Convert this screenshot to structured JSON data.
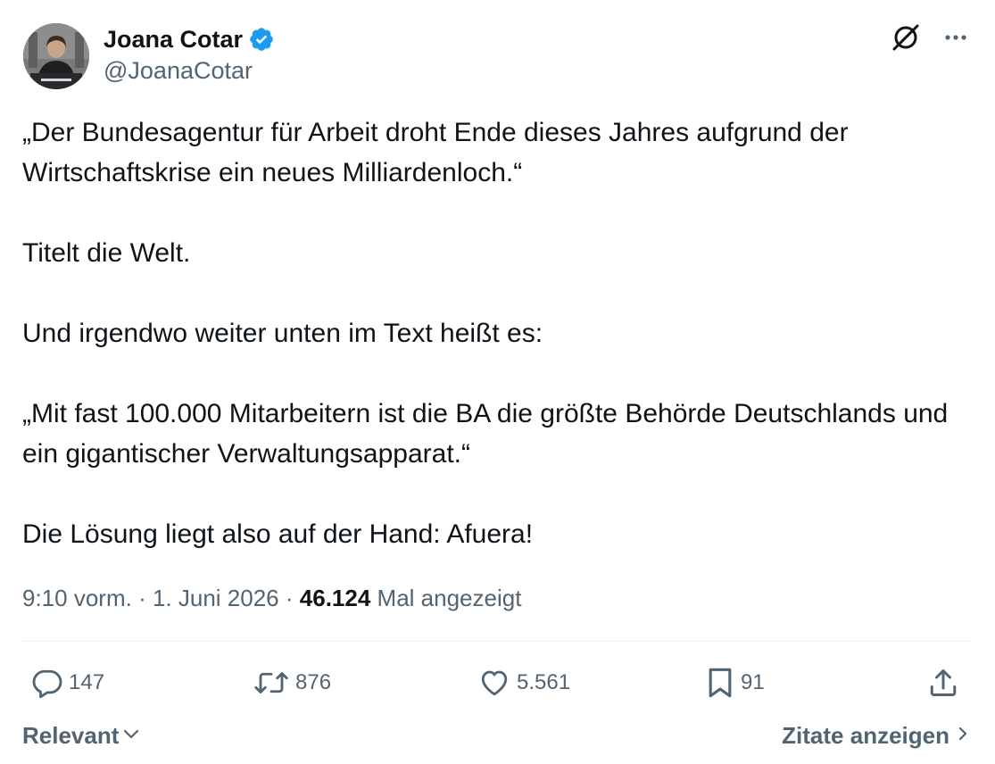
{
  "author": {
    "display_name": "Joana Cotar",
    "handle": "@JoanaCotar",
    "verified": true,
    "verified_color": "#1d9bf0"
  },
  "tweet": {
    "paragraphs": [
      "„Der Bundesagentur für Arbeit droht Ende dieses Jahres aufgrund der Wirtschaftskrise ein neues Milliardenloch.“",
      "Titelt die Welt.",
      "Und irgendwo weiter unten im Text heißt es:",
      "„Mit fast 100.000 Mitarbeitern ist die BA die größte Behörde Deutschlands und ein gigantischer Verwaltungsapparat.“",
      "Die Lösung liegt also auf der Hand: Afuera!"
    ]
  },
  "meta": {
    "time": "9:10 vorm.",
    "separator": "·",
    "date": "1. Juni 2026",
    "views_count": "46.124",
    "views_label": "Mal angezeigt"
  },
  "actions": {
    "replies": "147",
    "reposts": "876",
    "likes": "5.561",
    "bookmarks": "91"
  },
  "footer": {
    "sort_label": "Relevant",
    "quotes_label": "Zitate anzeigen"
  },
  "colors": {
    "text_primary": "#0f1419",
    "text_secondary": "#536471",
    "divider": "#eff3f4",
    "accent": "#1d9bf0"
  },
  "icons": {
    "grok": "grok-icon",
    "more": "more-icon",
    "reply": "reply-icon",
    "repost": "repost-icon",
    "like": "heart-icon",
    "bookmark": "bookmark-icon",
    "share": "share-icon"
  }
}
